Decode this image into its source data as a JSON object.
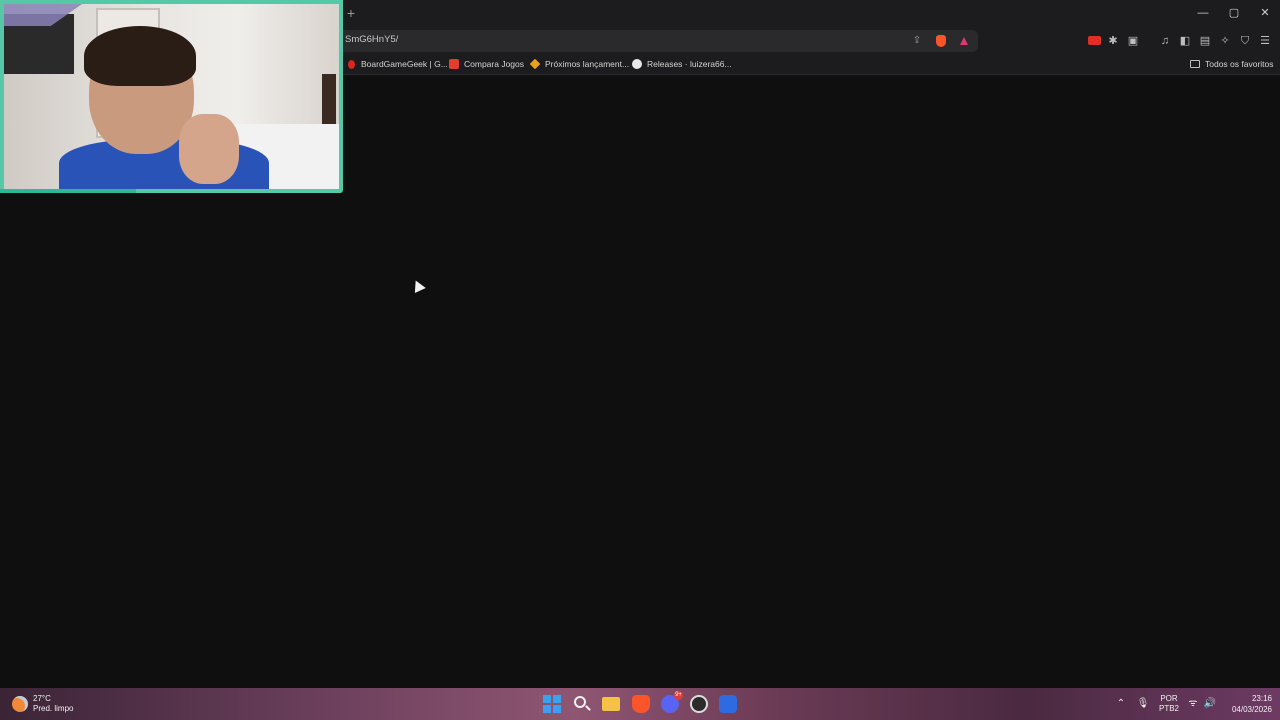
{
  "browser": {
    "new_tab_glyph": "+",
    "window_controls": {
      "minimize": "—",
      "maximize": "▢",
      "close": "✕"
    },
    "address_bar": {
      "url": "SmG6HnY5/"
    },
    "toolbar_icons": [
      "share-icon",
      "brave-shields-icon",
      "brave-rewards-icon",
      "youtube-icon",
      "extensions-icon",
      "screenshot-icon",
      "music-icon",
      "sidebar-icon",
      "wallet-icon",
      "leo-ai-icon",
      "vpn-icon",
      "menu-icon"
    ],
    "bookmarks": [
      {
        "label": "BoardGameGeek | G...",
        "icon": "boardgamegeek-icon"
      },
      {
        "label": "Compara Jogos",
        "icon": "compara-jogos-icon"
      },
      {
        "label": "Próximos lançament...",
        "icon": "diamond-icon"
      },
      {
        "label": "Releases · luizera66...",
        "icon": "github-icon"
      }
    ],
    "all_bookmarks_label": "Todos os favoritos",
    "colors": {
      "background": "#0f0f10",
      "chrome": "#1c1c1e",
      "webcam_border": "#56c8a8"
    }
  },
  "webcam": {
    "label": "webcam overlay"
  },
  "taskbar": {
    "weather": {
      "temp": "27°C",
      "condition": "Pred. limpo"
    },
    "apps": [
      "start-icon",
      "search-icon",
      "file-explorer-icon",
      "brave-icon",
      "discord-icon",
      "obs-icon",
      "app-icon"
    ],
    "discord_badge": "9+",
    "language": {
      "line1": "POR",
      "line2": "PTB2"
    },
    "time": "23:16",
    "date": "04/03/2026"
  }
}
